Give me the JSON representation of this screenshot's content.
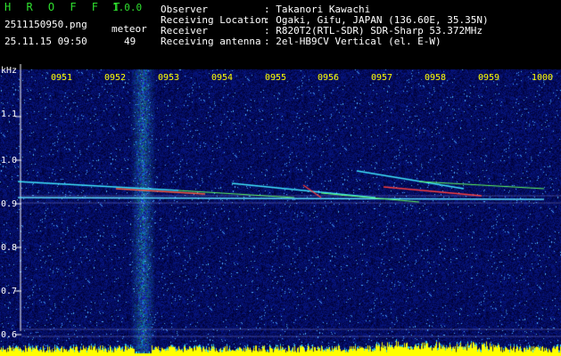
{
  "header": {
    "app_name": "H R O F F T",
    "version": "1.0.0",
    "filename": "2511150950.png",
    "datetime": "25.11.15 09:50",
    "counter_label": "meteor",
    "counter_value": "49",
    "fields": [
      {
        "label": "Observer",
        "value": ": Takanori Kawachi"
      },
      {
        "label": "Receiving Location",
        "value": ": Ogaki, Gifu, JAPAN (136.60E, 35.35N)"
      },
      {
        "label": "Receiver",
        "value": ": R820T2(RTL-SDR) SDR-Sharp 53.372MHz"
      },
      {
        "label": "Receiving antenna",
        "value": ": 2el-HB9CV Vertical (el. E-W)"
      }
    ]
  },
  "axis": {
    "y_unit": "kHz",
    "y_ticks": [
      "1.1",
      "1.0",
      "0.9",
      "0.8",
      "0.7",
      "0.6"
    ],
    "x_ticks": [
      "0951",
      "0952",
      "0953",
      "0954",
      "0955",
      "0956",
      "0957",
      "0958",
      "0959",
      "1000"
    ]
  },
  "colors": {
    "background": "#000000",
    "noise_base": "#10106a",
    "header_green": "#2fe02f",
    "tick_label": "#ffff00",
    "signal_cyan": "#40e8ff",
    "signal_green": "#60ff60",
    "signal_red": "#ff4040",
    "level_bar": "#ffff00"
  }
}
